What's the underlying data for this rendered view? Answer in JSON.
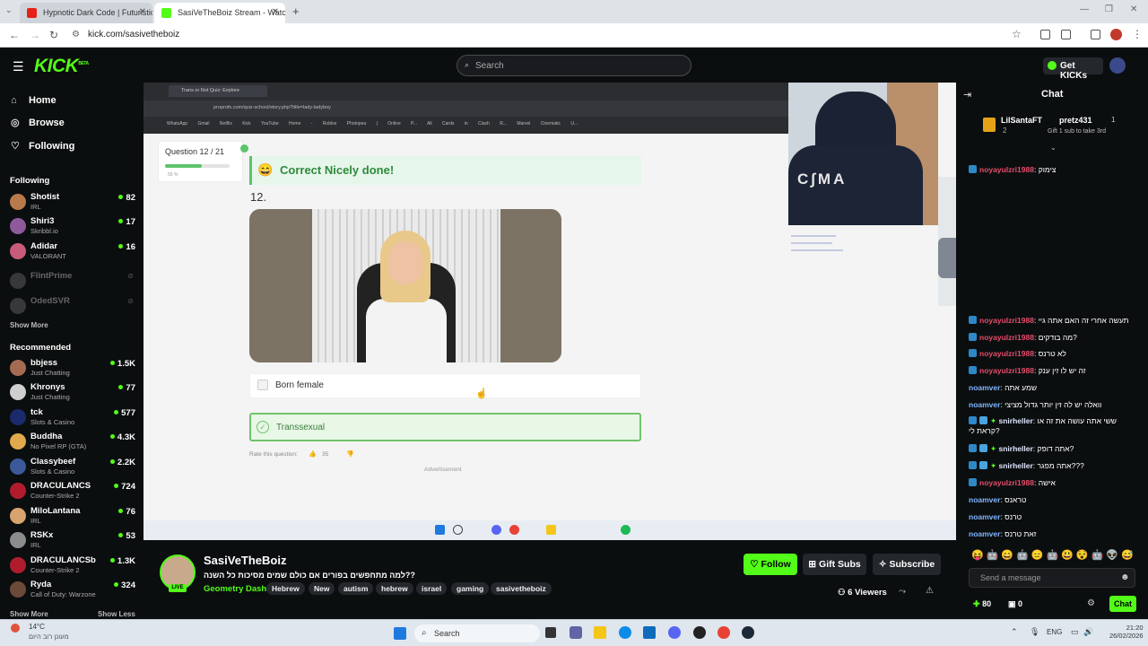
{
  "browser": {
    "tabs": [
      {
        "title": "Hypnotic Dark Code | Futuristic"
      },
      {
        "title": "SasiVeTheBoiz Stream - Watch"
      }
    ],
    "url": "kick.com/sasivetheboiz"
  },
  "header": {
    "logo": "KICK",
    "logo_badge": "BETA",
    "search_placeholder": "Search",
    "get_kicks": "Get KICKs"
  },
  "sidebar": {
    "nav": [
      {
        "label": "Home",
        "icon": "home-icon"
      },
      {
        "label": "Browse",
        "icon": "compass-icon"
      },
      {
        "label": "Following",
        "icon": "heart-icon"
      }
    ],
    "following_title": "Following",
    "following": [
      {
        "name": "Shotist",
        "category": "IRL",
        "viewers": "82"
      },
      {
        "name": "Shiri3",
        "category": "Skribbl.io",
        "viewers": "17"
      },
      {
        "name": "Adidar",
        "category": "VALORANT",
        "viewers": "16"
      },
      {
        "name": "FlintPrime",
        "category": "",
        "viewers": ""
      },
      {
        "name": "OdedSVR",
        "category": "",
        "viewers": ""
      }
    ],
    "show_more": "Show More",
    "recommended_title": "Recommended",
    "recommended": [
      {
        "name": "bbjess",
        "category": "Just Chatting",
        "viewers": "1.5K"
      },
      {
        "name": "Khronys",
        "category": "Just Chatting",
        "viewers": "77"
      },
      {
        "name": "tck",
        "category": "Slots & Casino",
        "viewers": "577"
      },
      {
        "name": "Buddha",
        "category": "No Pixel RP (GTA)",
        "viewers": "4.3K"
      },
      {
        "name": "Classybeef",
        "category": "Slots & Casino",
        "viewers": "2.2K"
      },
      {
        "name": "DRACULANCS",
        "category": "Counter-Strike 2",
        "viewers": "724"
      },
      {
        "name": "MiloLantana",
        "category": "IRL",
        "viewers": "76"
      },
      {
        "name": "RSKx",
        "category": "IRL",
        "viewers": "53"
      },
      {
        "name": "DRACULANCSb",
        "category": "Counter-Strike 2",
        "viewers": "1.3K"
      },
      {
        "name": "Ryda",
        "category": "Call of Duty: Warzone",
        "viewers": "324"
      }
    ],
    "show_more_2": "Show More",
    "show_less": "Show Less"
  },
  "stream": {
    "inner_tab": "Trans or Not Quiz: Explore",
    "inner_url": "proprofs.com/quiz-school/story.php?title=lady-ladyboy",
    "bookmarks": [
      "WhatsApp",
      "Gmail",
      "Netflix",
      "Kick",
      "YouTube",
      "Home - Roblox",
      "Photopea | Online P...",
      "All Cards in Clash R...",
      "Marvel Cinematic U..."
    ],
    "question_label": "Question 12 / 21",
    "progress_pct": 57,
    "progress_text": "55 %",
    "correct_text": "Correct Nicely done!",
    "question_number": "12.",
    "option1": "Born female",
    "option2": "Transsexual",
    "rate_label": "Rate this question:",
    "rate_count": "35",
    "advertisement": "Advertisement"
  },
  "chat": {
    "title": "Chat",
    "pinned_user": "LilSantaFT",
    "pinned_count": "2",
    "gifter_user": "pretz431",
    "gifter_count": "1",
    "gifter_text": "Gift 1 sub to take 3rd",
    "messages": [
      {
        "user": "noyayulzri1988",
        "text": "צימוק"
      },
      {
        "user": "noyayulzri1988",
        "text": "תעשה אחרי זה האם אתה גיי"
      },
      {
        "user": "noyayulzri1988",
        "text": "מה בודקים?"
      },
      {
        "user": "noyayulzri1988",
        "text": "לא טרנס"
      },
      {
        "user": "noyayulzri1988",
        "text": "זה יש לו זין ענק"
      },
      {
        "user": "noamver",
        "text": "שמע אתה"
      },
      {
        "user": "noamver",
        "text": "וואלה יש לה זין יותר גדול מציצי"
      },
      {
        "user": "snirheller",
        "text": "ששי אתה עושה את זה או קראת לי?"
      },
      {
        "user": "snirheller",
        "text": "אתה דופק?"
      },
      {
        "user": "snirheller",
        "text": "אתה מפגר???"
      },
      {
        "user": "noyayulzri1988",
        "text": "אישה"
      },
      {
        "user": "noamver",
        "text": "טראנס"
      },
      {
        "user": "noamver",
        "text": "טרנס"
      },
      {
        "user": "noamver",
        "text": "זאת טרנס"
      }
    ],
    "input_placeholder": "Send a message",
    "points": "80",
    "bank": "0",
    "chat_button": "Chat"
  },
  "streamer": {
    "name": "SasiVeTheBoiz",
    "live": "LIVE",
    "title": "למה מתחפשים בפורים אם כולם שמים מסיכות כל השנה??",
    "category": "Geometry Dash",
    "tags": [
      "Hebrew",
      "New",
      "autism",
      "hebrew",
      "israel",
      "gaming",
      "sasivetheboiz"
    ],
    "follow": "Follow",
    "gift_subs": "Gift Subs",
    "subscribe": "Subscribe",
    "viewers": "6 Viewers"
  },
  "taskbar": {
    "weather_temp": "14°C",
    "weather_text": "מעונן רוב היום",
    "search": "Search",
    "lang": "ENG",
    "time": "21:20",
    "date": "26/02/2026"
  },
  "colors": {
    "kick_green": "#53fc18",
    "background": "#0b0e0f",
    "correct_green": "#5cc46a"
  }
}
